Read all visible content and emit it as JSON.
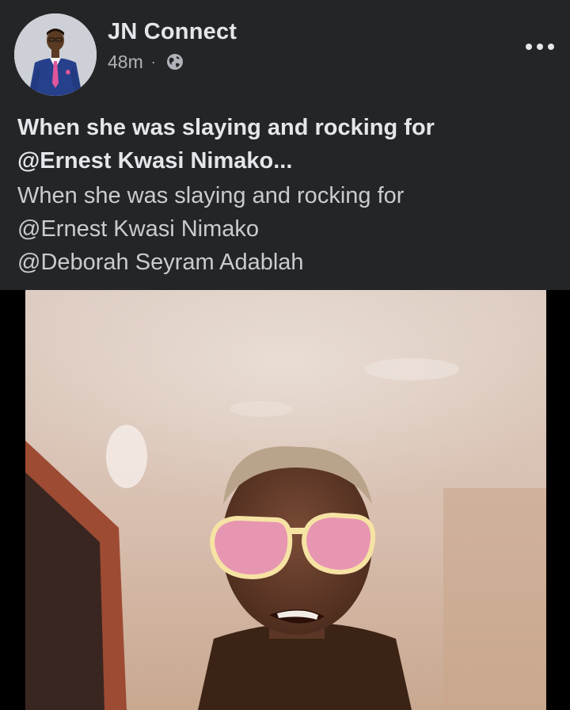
{
  "post": {
    "page_name": "JN Connect",
    "time_ago": "48m",
    "separator": "·",
    "privacy_icon": "globe-icon",
    "more_icon": "more-options-icon",
    "title_line1": "When she was slaying and rocking for",
    "title_line2": "@Ernest Kwasi Nimako...",
    "body_lines": [
      "When she was slaying and rocking for",
      "@Ernest Kwasi Nimako",
      "@Deborah Seyram Adablah"
    ]
  },
  "colors": {
    "background": "#242526",
    "text_primary": "#e4e6eb",
    "text_secondary": "#b0b3b8"
  }
}
